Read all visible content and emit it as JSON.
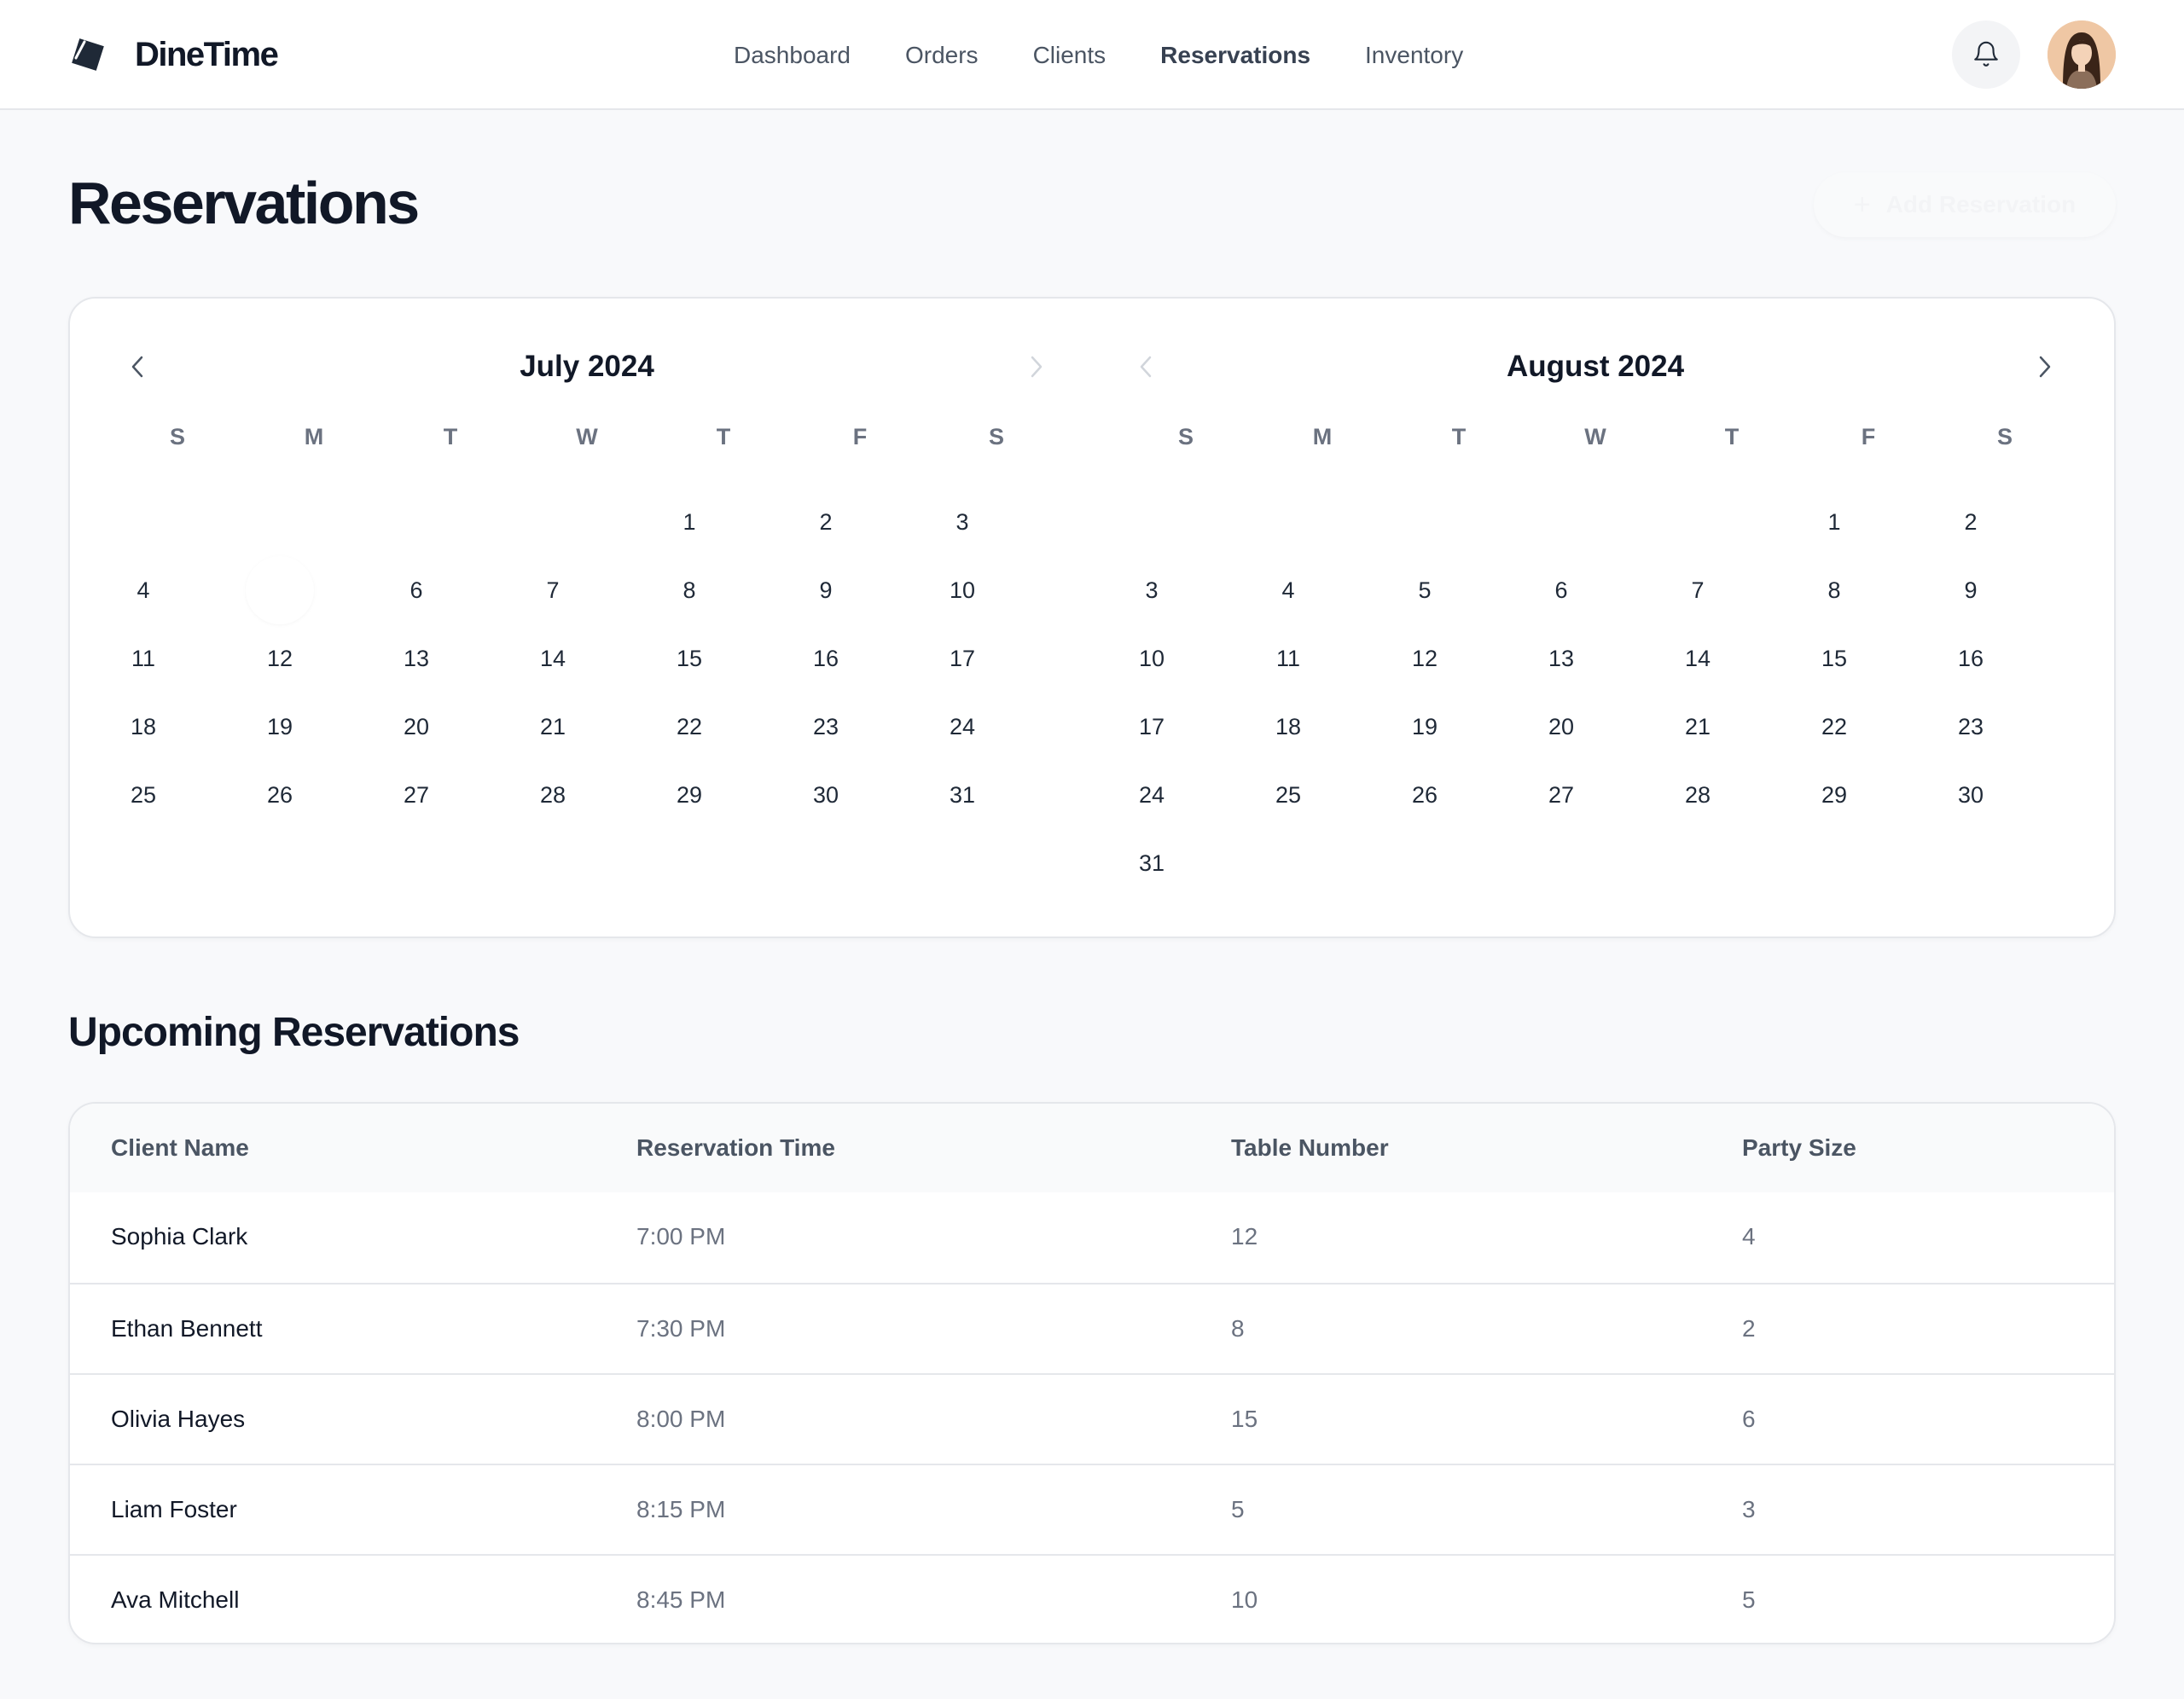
{
  "app": {
    "name": "DineTime"
  },
  "nav": {
    "items": [
      {
        "label": "Dashboard"
      },
      {
        "label": "Orders"
      },
      {
        "label": "Clients"
      },
      {
        "label": "Reservations"
      },
      {
        "label": "Inventory"
      }
    ],
    "active": "Reservations"
  },
  "header": {
    "bell_icon": "bell-icon",
    "avatar_icon": "user-avatar"
  },
  "page": {
    "title": "Reservations",
    "add_button_label": "Add Reservation"
  },
  "calendar": {
    "weekdays": [
      "S",
      "M",
      "T",
      "W",
      "T",
      "F",
      "S"
    ],
    "months": [
      {
        "title": "July 2024",
        "first_weekday": 4,
        "days": 31,
        "highlighted_day": 5
      },
      {
        "title": "August 2024",
        "first_weekday": 5,
        "days": 31
      }
    ]
  },
  "upcoming": {
    "title": "Upcoming Reservations",
    "columns": [
      "Client Name",
      "Reservation Time",
      "Table Number",
      "Party Size"
    ],
    "rows": [
      [
        "Sophia Clark",
        "7:00 PM",
        "12",
        "4"
      ],
      [
        "Ethan Bennett",
        "7:30 PM",
        "8",
        "2"
      ],
      [
        "Olivia Hayes",
        "8:00 PM",
        "15",
        "6"
      ],
      [
        "Liam Foster",
        "8:15 PM",
        "5",
        "3"
      ],
      [
        "Ava Mitchell",
        "8:45 PM",
        "10",
        "5"
      ]
    ]
  },
  "colors": {
    "primary": "#111827",
    "muted": "#6b7280",
    "background": "#f8f9fb",
    "border": "#e5e7eb"
  }
}
